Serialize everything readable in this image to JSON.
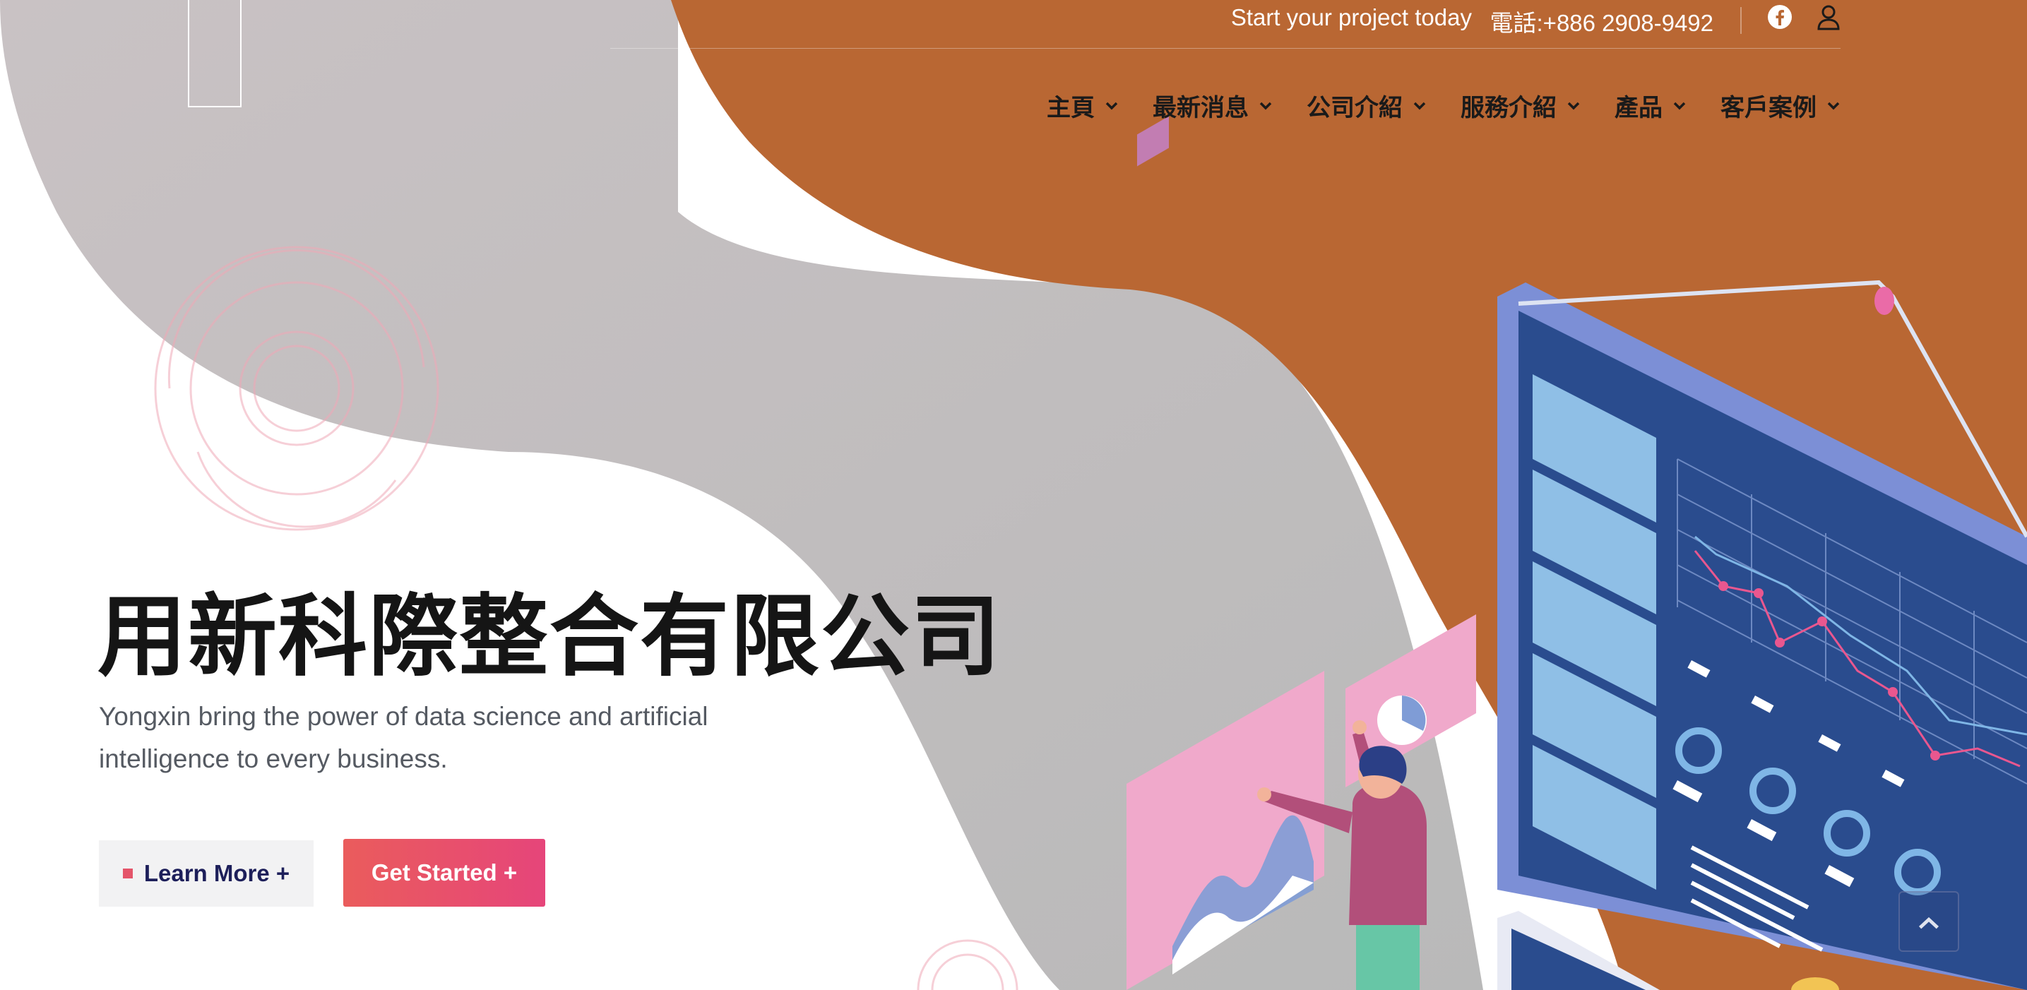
{
  "topbar": {
    "tagline": "Start your project today",
    "phone": "電話:+886 2908-9492",
    "icons": [
      "facebook-icon",
      "user-icon"
    ]
  },
  "nav": {
    "items": [
      {
        "label": "主頁"
      },
      {
        "label": "最新消息"
      },
      {
        "label": "公司介紹"
      },
      {
        "label": "服務介紹"
      },
      {
        "label": "產品"
      },
      {
        "label": "客戶案例"
      }
    ]
  },
  "hero": {
    "title": "用新科際整合有限公司",
    "subtitle": "Yongxin bring the power of data science and artificial intelligence to every business.",
    "learn_more": "Learn More +",
    "get_started": "Get Started +"
  },
  "colors": {
    "orange": "#b96733",
    "gray": "#c2bfc0",
    "accent": "#e6457a",
    "nav_text": "#1a1a1a"
  }
}
